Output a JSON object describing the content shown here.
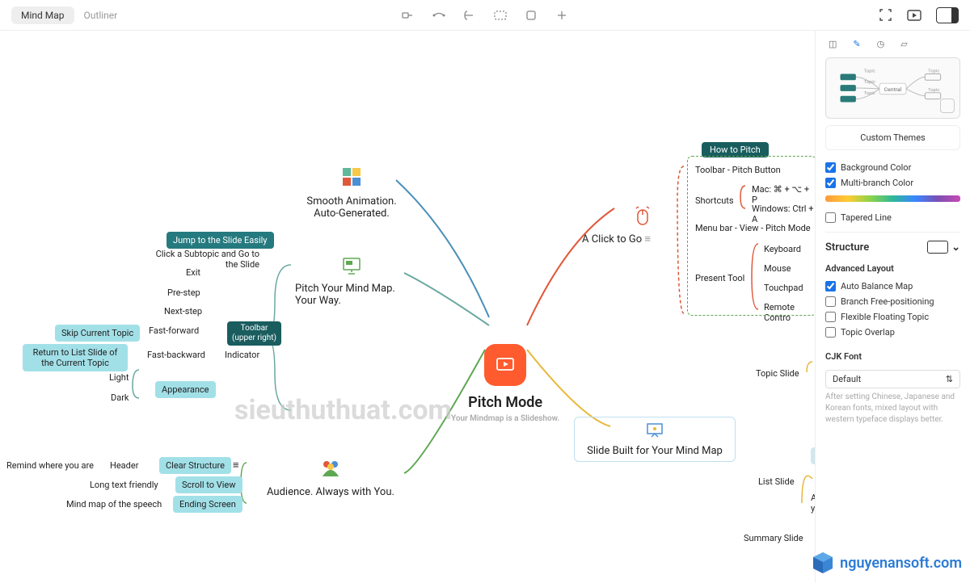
{
  "views": {
    "mindmap": "Mind Map",
    "outliner": "Outliner"
  },
  "central": {
    "title": "Pitch Mode",
    "subtitle": "Your Mindmap is a Slideshow."
  },
  "branches": {
    "top_left": "Smooth Animation.\nAuto-Generated.",
    "mid_left": "Pitch Your Mind Map.\nYour Way.",
    "bottom_left": "Audience. Always with You.",
    "top_right": "A Click to Go",
    "right_box": "Slide Built for Your Mind Map"
  },
  "left_cluster": {
    "jump": "Jump to the Slide Easily",
    "click_sub": "Click a Subtopic and Go to the Slide",
    "exit": "Exit",
    "prestep": "Pre-step",
    "nextstep": "Next-step",
    "toolbar_tag": "Toolbar\n(upper right)",
    "indicator": "Indicator",
    "skip": "Skip Current Topic",
    "fast_fwd": "Fast-forward",
    "return_list": "Return to List Slide of the Current Topic",
    "fast_bwd": "Fast-backward",
    "light": "Light",
    "dark": "Dark",
    "appearance": "Appearance"
  },
  "audience": {
    "remind": "Remind where you are",
    "header": "Header",
    "clear": "Clear Structure",
    "longtext": "Long text friendly",
    "scroll": "Scroll to View",
    "speech": "Mind map of the speech",
    "ending": "Ending Screen"
  },
  "right_cluster": {
    "how_to": "How to Pitch",
    "toolbar_pitch": "Toolbar - Pitch Button",
    "shortcuts": "Shortcuts",
    "mac": "Mac: ⌘ + ⌥ + P",
    "win": "Windows: Ctrl + A",
    "menubar": "Menu bar - View - Pitch Mode",
    "present": "Present Tool",
    "keyboard": "Keyboard",
    "mouse": "Mouse",
    "touchpad": "Touchpad",
    "remote": "Remote Contro",
    "topic_slide": "Topic Slide",
    "list_slide": "List Slide",
    "summary_slide": "Summary Slide",
    "p": "P",
    "a": "A\ny"
  },
  "panel": {
    "custom_themes": "Custom Themes",
    "bg_color": "Background Color",
    "multi_branch": "Multi-branch Color",
    "tapered": "Tapered Line",
    "structure": "Structure",
    "adv_layout": "Advanced Layout",
    "auto_balance": "Auto Balance Map",
    "free_pos": "Branch Free-positioning",
    "flex_float": "Flexible Floating Topic",
    "overlap": "Topic Overlap",
    "cjk_font": "CJK Font",
    "default": "Default",
    "cjk_help": "After setting Chinese, Japanese and Korean fonts, mixed layout with western typeface displays better."
  },
  "watermark1": "sieuthuthuat.com",
  "watermark2": "nguyenansoft.com"
}
